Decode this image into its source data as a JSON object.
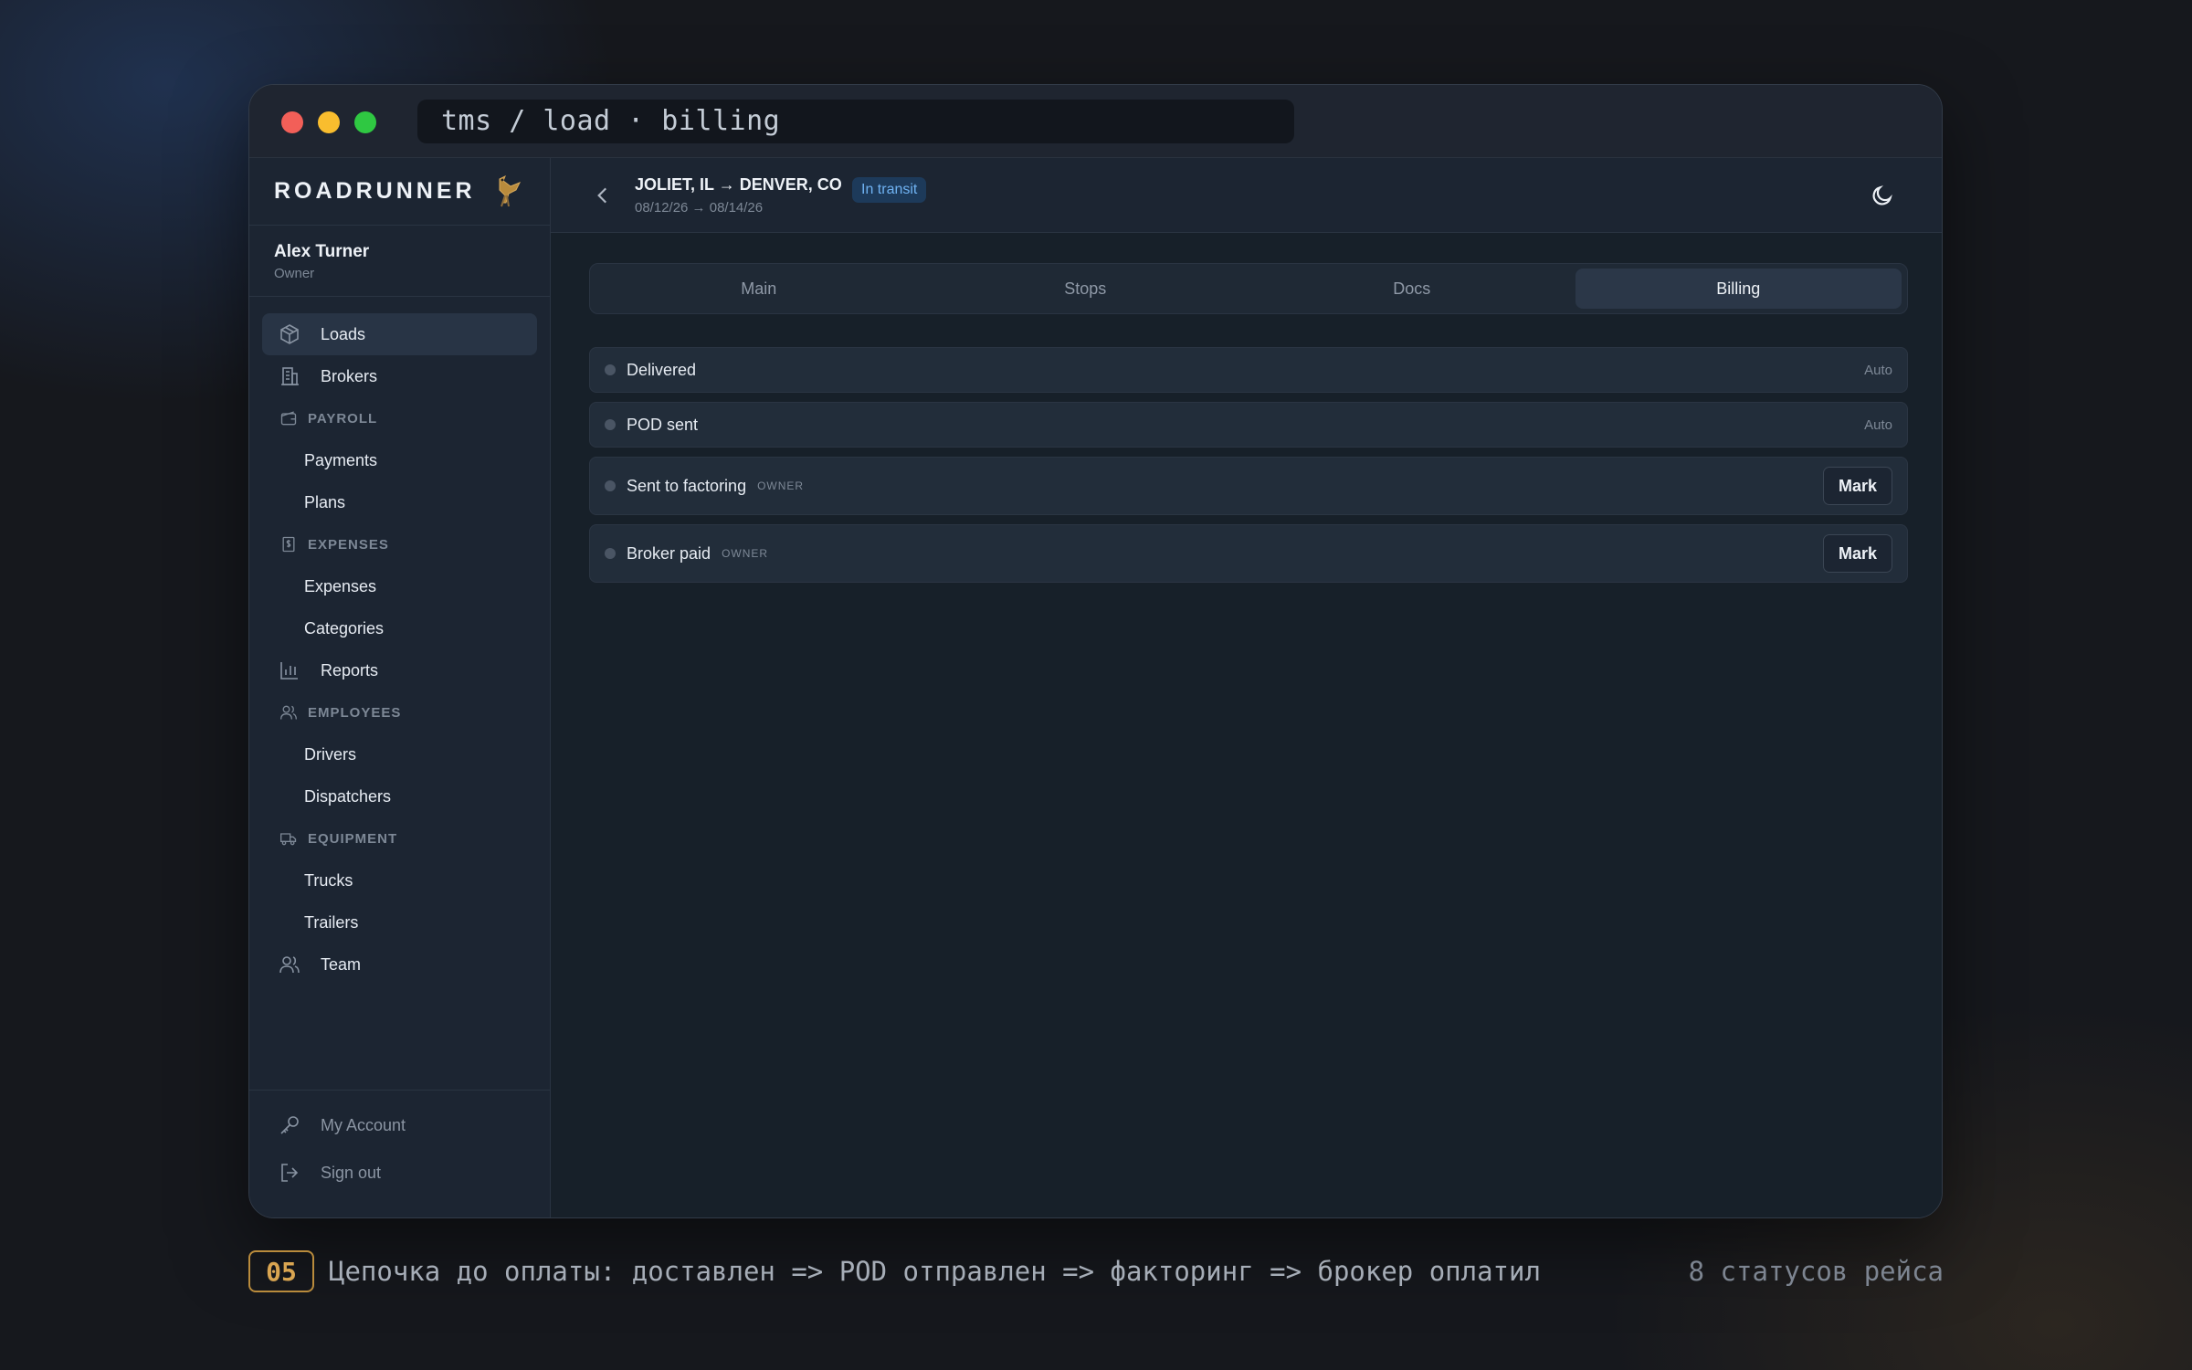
{
  "window": {
    "url": "tms / load · billing"
  },
  "sidebar": {
    "brand": "ROADRUNNER",
    "brand_icon": "roadrunner-bird-icon",
    "user": {
      "name": "Alex Turner",
      "role": "Owner"
    },
    "nav": {
      "loads": "Loads",
      "brokers": "Brokers",
      "payroll_section": "PAYROLL",
      "payments": "Payments",
      "plans": "Plans",
      "expenses_section": "EXPENSES",
      "expenses": "Expenses",
      "categories": "Categories",
      "reports": "Reports",
      "employees_section": "EMPLOYEES",
      "drivers": "Drivers",
      "dispatchers": "Dispatchers",
      "equipment_section": "EQUIPMENT",
      "trucks": "Trucks",
      "trailers": "Trailers",
      "team": "Team"
    },
    "footer": {
      "account": "My Account",
      "signout": "Sign out"
    }
  },
  "header": {
    "route": "JOLIET, IL → DENVER, CO",
    "dates": "08/12/26 → 08/14/26",
    "status_badge": "In transit"
  },
  "tabs": {
    "main": "Main",
    "stops": "Stops",
    "docs": "Docs",
    "billing": "Billing",
    "active": "Billing"
  },
  "billing_statuses": [
    {
      "label": "Delivered",
      "mode": "Auto"
    },
    {
      "label": "POD sent",
      "mode": "Auto"
    },
    {
      "label": "Sent to factoring",
      "role": "OWNER",
      "action": "Mark"
    },
    {
      "label": "Broker paid",
      "role": "OWNER",
      "action": "Mark"
    }
  ],
  "caption": {
    "step": "05",
    "text": "Цепочка до оплаты: доставлен => POD отправлен => факторинг => брокер оплатил",
    "count": "8 статусов рейса"
  },
  "colors": {
    "accent_badge": "#6fb2f2",
    "step_accent": "#d9a551"
  }
}
